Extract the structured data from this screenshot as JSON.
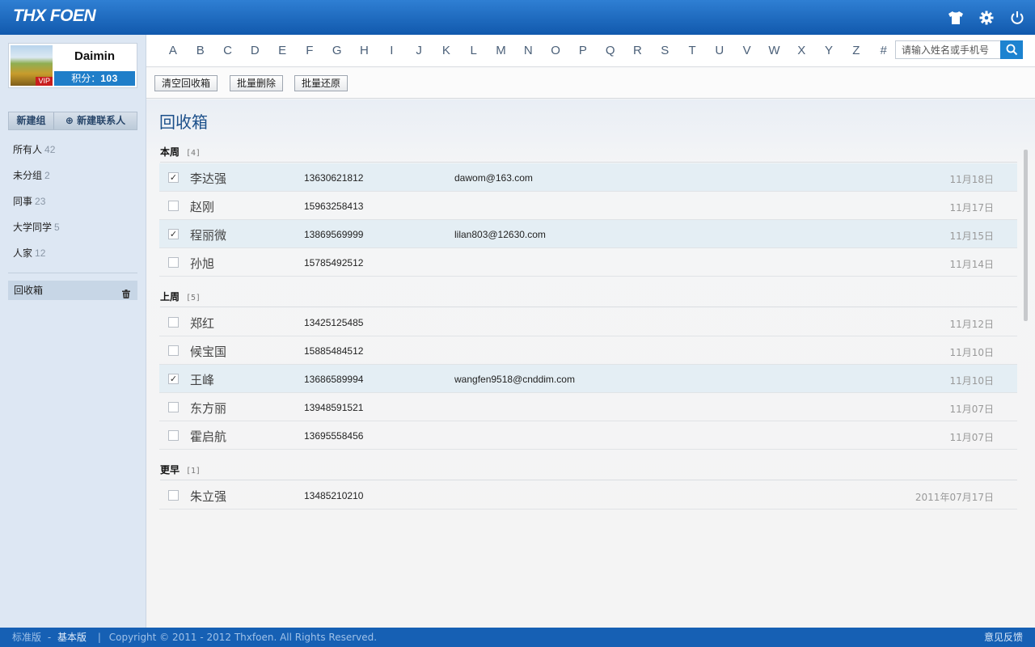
{
  "app": {
    "logo": "THX FOEN"
  },
  "profile": {
    "name": "Daimin",
    "badge": "VIP",
    "points_label": "积分：",
    "points_value": "103"
  },
  "sidebar": {
    "new_group": "新建组",
    "new_contact": "⊕ 新建联系人",
    "groups": [
      {
        "label": "所有人",
        "count": "42"
      },
      {
        "label": "未分组",
        "count": "2"
      },
      {
        "label": "同事",
        "count": "23"
      },
      {
        "label": "大学同学",
        "count": "5"
      },
      {
        "label": "人家",
        "count": "12"
      }
    ],
    "trash": "回收箱"
  },
  "alphabet": [
    "A",
    "B",
    "C",
    "D",
    "E",
    "F",
    "G",
    "H",
    "I",
    "J",
    "K",
    "L",
    "M",
    "N",
    "O",
    "P",
    "Q",
    "R",
    "S",
    "T",
    "U",
    "V",
    "W",
    "X",
    "Y",
    "Z",
    "#"
  ],
  "search": {
    "placeholder": "请输入姓名或手机号"
  },
  "toolbar": {
    "empty": "清空回收箱",
    "batch_delete": "批量删除",
    "batch_restore": "批量还原"
  },
  "page": {
    "title": "回收箱"
  },
  "sections": [
    {
      "label": "本周",
      "count": "[4]",
      "rows": [
        {
          "checked": true,
          "name": "李达强",
          "phone": "13630621812",
          "email": "dawom@163.com",
          "date": "11月18日"
        },
        {
          "checked": false,
          "name": "赵刚",
          "phone": "15963258413",
          "email": "",
          "date": "11月17日"
        },
        {
          "checked": true,
          "name": "程丽微",
          "phone": "13869569999",
          "email": "lilan803@12630.com",
          "date": "11月15日"
        },
        {
          "checked": false,
          "name": "孙旭",
          "phone": "15785492512",
          "email": "",
          "date": "11月14日"
        }
      ]
    },
    {
      "label": "上周",
      "count": "[5]",
      "rows": [
        {
          "checked": false,
          "name": "郑红",
          "phone": "13425125485",
          "email": "",
          "date": "11月12日"
        },
        {
          "checked": false,
          "name": "候宝国",
          "phone": "15885484512",
          "email": "",
          "date": "11月10日"
        },
        {
          "checked": true,
          "name": "王峰",
          "phone": "13686589994",
          "email": "wangfen9518@cnddim.com",
          "date": "11月10日"
        },
        {
          "checked": false,
          "name": "东方丽",
          "phone": "13948591521",
          "email": "",
          "date": "11月07日"
        },
        {
          "checked": false,
          "name": "霍启航",
          "phone": "13695558456",
          "email": "",
          "date": "11月07日"
        }
      ]
    },
    {
      "label": "更早",
      "count": "[1]",
      "rows": [
        {
          "checked": false,
          "name": "朱立强",
          "phone": "13485210210",
          "email": "",
          "date": "2011年07月17日"
        }
      ]
    }
  ],
  "footer": {
    "standard": "标准版",
    "sep1": "-",
    "basic": "基本版",
    "sep2": "|",
    "copyright": "Copyright © 2011 - 2012 Thxfoen. All Rights Reserved.",
    "feedback": "意见反馈"
  },
  "colors": {
    "brand": "#1660b4",
    "accent": "#1d83d0",
    "selected_row": "#e4eef4"
  }
}
